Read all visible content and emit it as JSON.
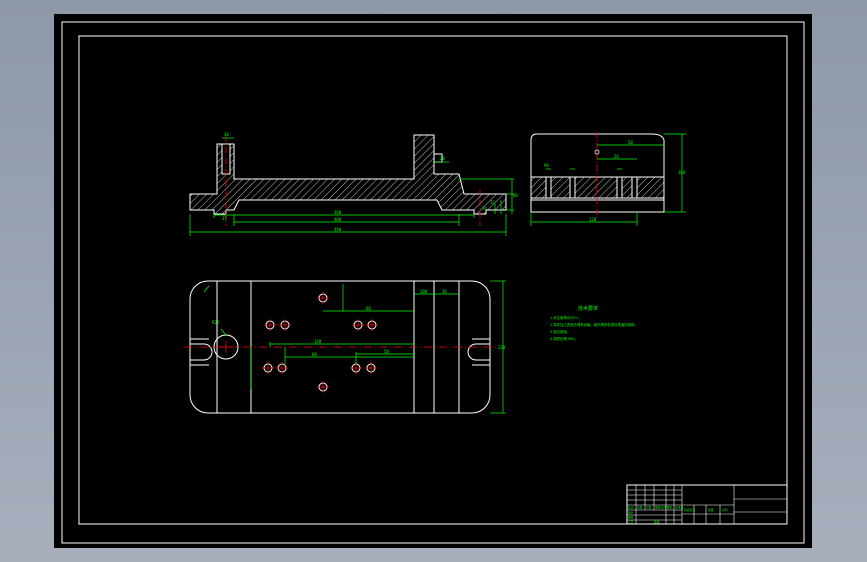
{
  "colors": {
    "background": "#000000",
    "outline": "#ffffff",
    "dimension": "#00ff00",
    "centerline": "#ff0000",
    "hatch": "#c0c0c0",
    "note_text": "#00ff00"
  },
  "notes": {
    "title": "技术要求",
    "lines": [
      "1.未注倒角均为C1。",
      "2.零件加工表面不得有划痕、碰伤等损伤零件表面的缺陷。",
      "3.锐边倒钝。",
      "4.调质处理 HRC。"
    ]
  },
  "title_block": {
    "labels": [
      "标记",
      "处数",
      "分区",
      "更改文件号",
      "签名",
      "年月日",
      "设计",
      "审核",
      "工艺",
      "批准",
      "阶段标记",
      "重量",
      "比例"
    ]
  },
  "dimension_labels": {
    "front_view": [
      "30",
      "400",
      "380",
      "440",
      "20",
      "35",
      "15",
      "60",
      "10"
    ],
    "side_view": [
      "50",
      "20",
      "90",
      "120",
      "160"
    ],
    "plan_view": [
      "R25",
      "60",
      "140",
      "80",
      "50",
      "220",
      "30",
      "200"
    ]
  }
}
